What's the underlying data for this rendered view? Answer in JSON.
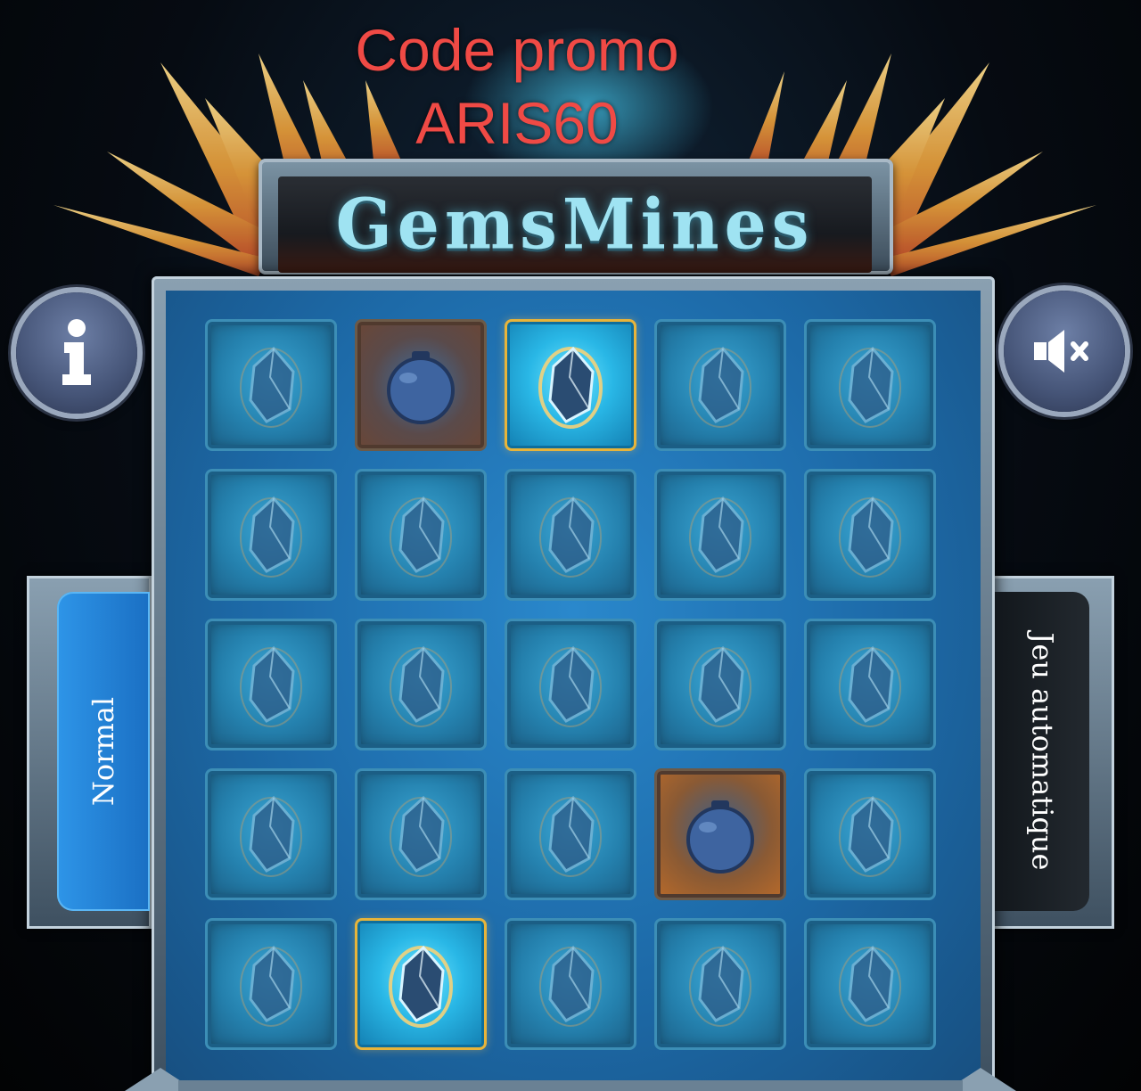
{
  "promo": {
    "line1": "Code promo",
    "line2": "ARIS60"
  },
  "game": {
    "title": "GemsMines"
  },
  "buttons": {
    "info_icon": "info-icon",
    "sound_icon": "speaker-muted-icon"
  },
  "modes": {
    "normal": "Normal",
    "auto": "Jeu automatique",
    "active": "Normal"
  },
  "board": {
    "rows": 5,
    "cols": 5,
    "cells": [
      [
        "hidden",
        "bomb",
        "gem",
        "hidden",
        "hidden"
      ],
      [
        "hidden",
        "hidden",
        "hidden",
        "hidden",
        "hidden"
      ],
      [
        "hidden",
        "hidden",
        "hidden",
        "hidden",
        "hidden"
      ],
      [
        "hidden",
        "hidden",
        "hidden",
        "bomb-hot",
        "hidden"
      ],
      [
        "hidden",
        "gem",
        "hidden",
        "hidden",
        "hidden"
      ]
    ]
  },
  "colors": {
    "promo": "#f04a45",
    "title": "#9fe3f2",
    "tab_active": "#2e95e8",
    "board": "#1d6aa8"
  }
}
